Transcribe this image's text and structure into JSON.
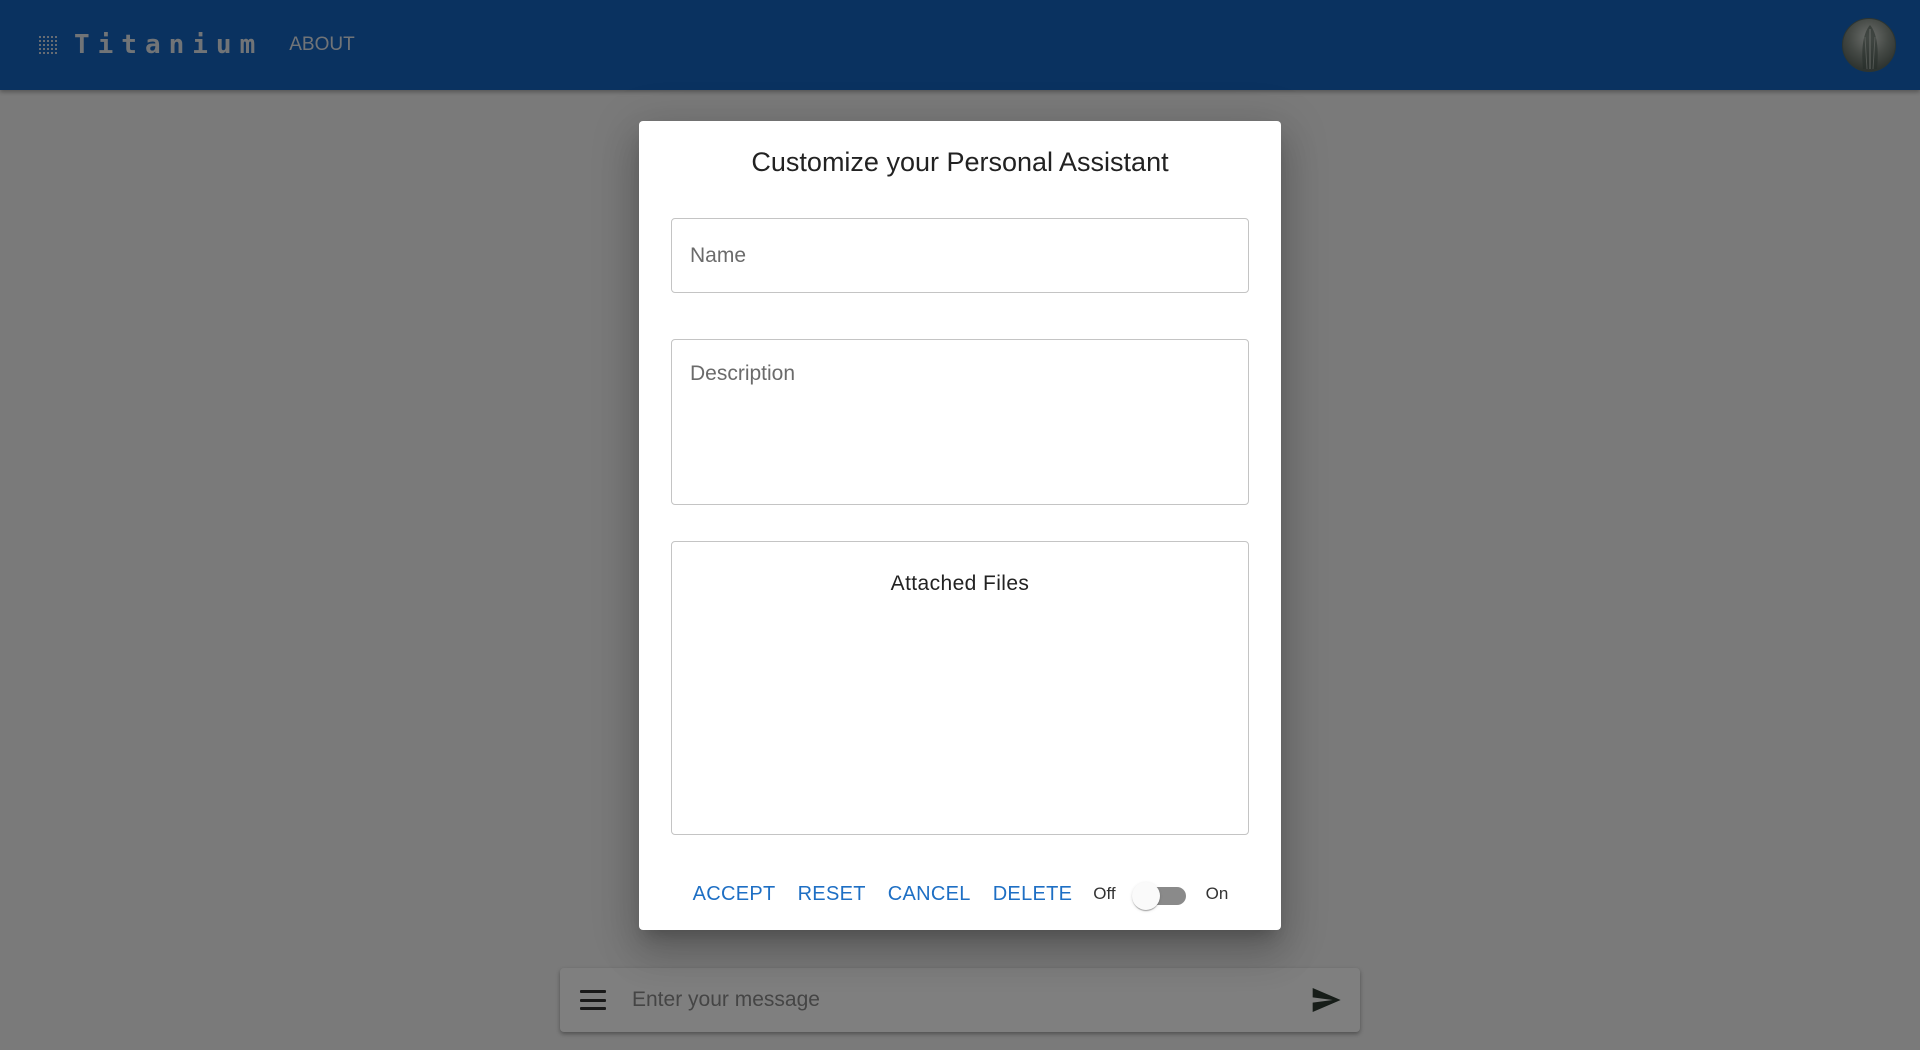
{
  "appbar": {
    "brand_icon": "apps-grid-icon",
    "title": "Titanium",
    "nav_about": "ABOUT",
    "avatar_icon": "user-avatar"
  },
  "composer": {
    "menu_icon": "menu-icon",
    "placeholder": "Enter your message",
    "value": "",
    "send_icon": "send-icon"
  },
  "dialog": {
    "title": "Customize your Personal Assistant",
    "name_field": {
      "placeholder": "Name",
      "value": ""
    },
    "description_field": {
      "placeholder": "Description",
      "value": ""
    },
    "files_title": "Attached Files",
    "actions": {
      "accept": "ACCEPT",
      "reset": "RESET",
      "cancel": "CANCEL",
      "delete": "DELETE"
    },
    "toggle": {
      "off_label": "Off",
      "on_label": "On",
      "state": "off"
    }
  },
  "colors": {
    "appbar": "#1565c0",
    "action_text": "#1e6fc4",
    "backdrop": "rgba(0,0,0,0.5)"
  }
}
